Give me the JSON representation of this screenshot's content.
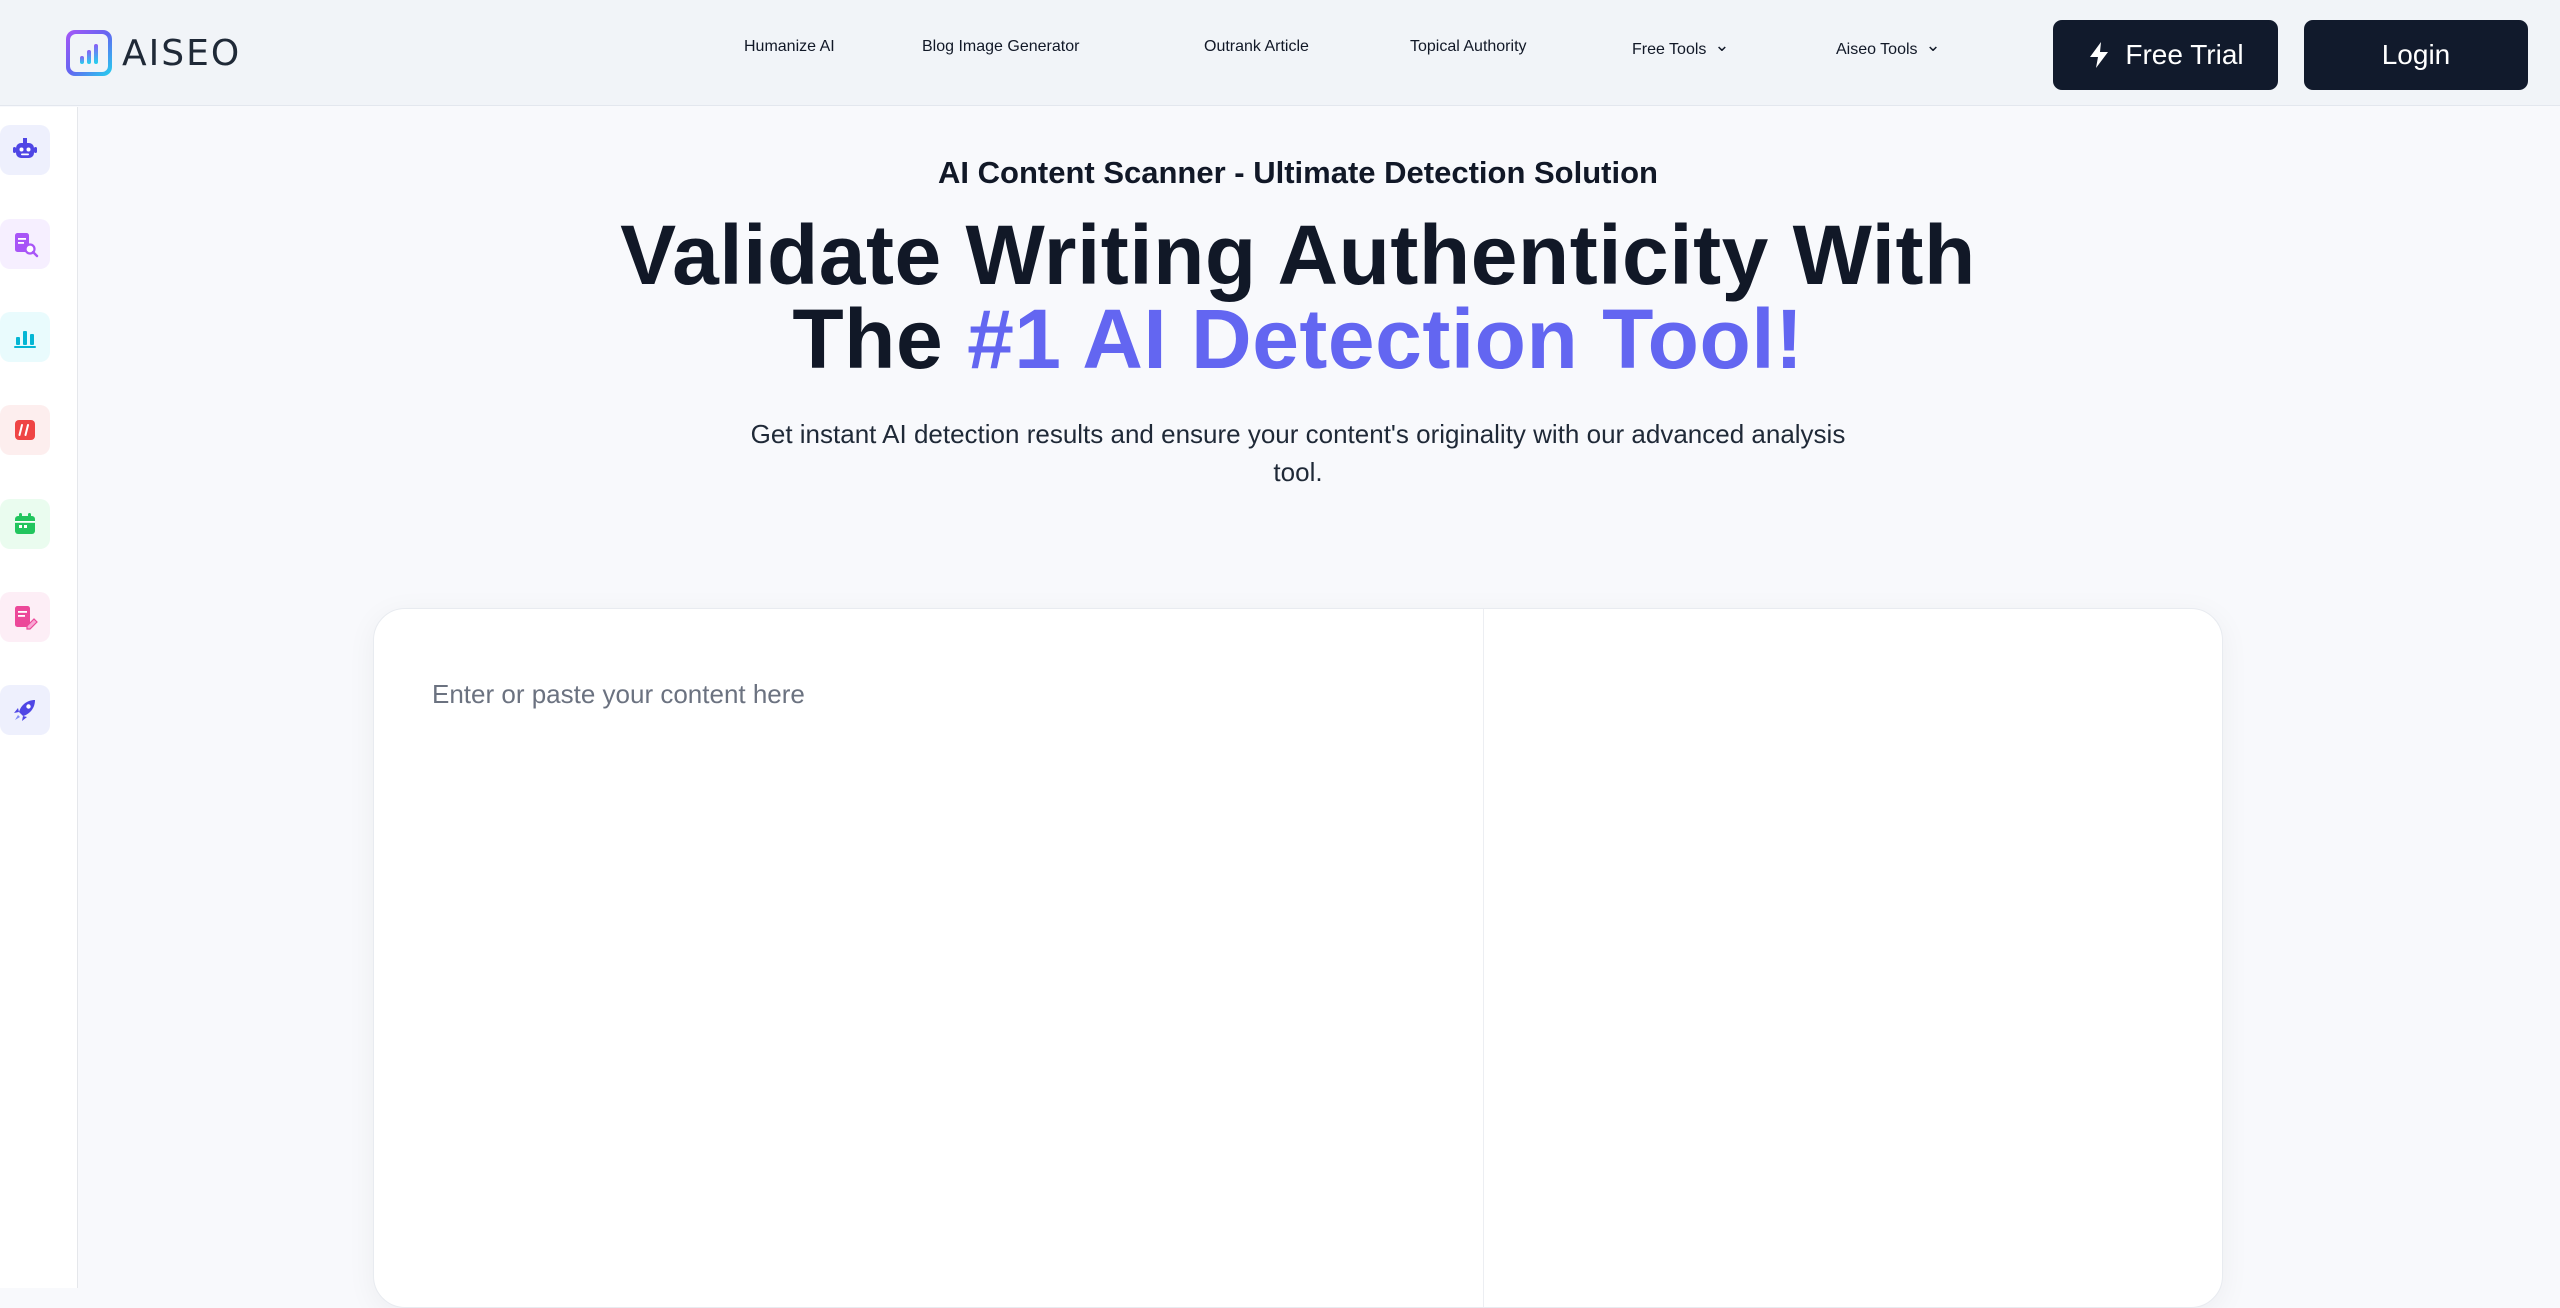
{
  "brand": {
    "name": "AISEO"
  },
  "nav": {
    "items": [
      {
        "label": "Humanize AI"
      },
      {
        "label": "Blog Image Generator"
      },
      {
        "label": "Outrank Article"
      },
      {
        "label": "Topical Authority"
      },
      {
        "label": "Free Tools"
      },
      {
        "label": "Aiseo Tools"
      }
    ],
    "free_trial": "Free Trial",
    "login": "Login"
  },
  "sidebar": {
    "items": [
      {
        "icon": "robot-icon",
        "color": "#4f46e5"
      },
      {
        "icon": "document-search-icon",
        "color": "#a855f7"
      },
      {
        "icon": "bar-chart-icon",
        "color": "#06b6d4"
      },
      {
        "icon": "code-slash-icon",
        "color": "#ef4444"
      },
      {
        "icon": "calendar-icon",
        "color": "#22c55e"
      },
      {
        "icon": "document-edit-icon",
        "color": "#ec4899"
      },
      {
        "icon": "rocket-icon",
        "color": "#4f46e5"
      }
    ]
  },
  "hero": {
    "eyebrow": "AI Content Scanner - Ultimate Detection Solution",
    "headline_line1": "Validate Writing Authenticity With",
    "headline_line2_prefix": "The ",
    "headline_line2_accent": "#1 AI Detection Tool!",
    "subtext": "Get instant AI detection results and ensure your content's originality with our advanced analysis tool."
  },
  "tool": {
    "input_placeholder": "Enter or paste your content here",
    "input_value": ""
  },
  "colors": {
    "accent": "#6366f1",
    "dark": "#111a2c",
    "header_bg": "#f1f4f8"
  }
}
